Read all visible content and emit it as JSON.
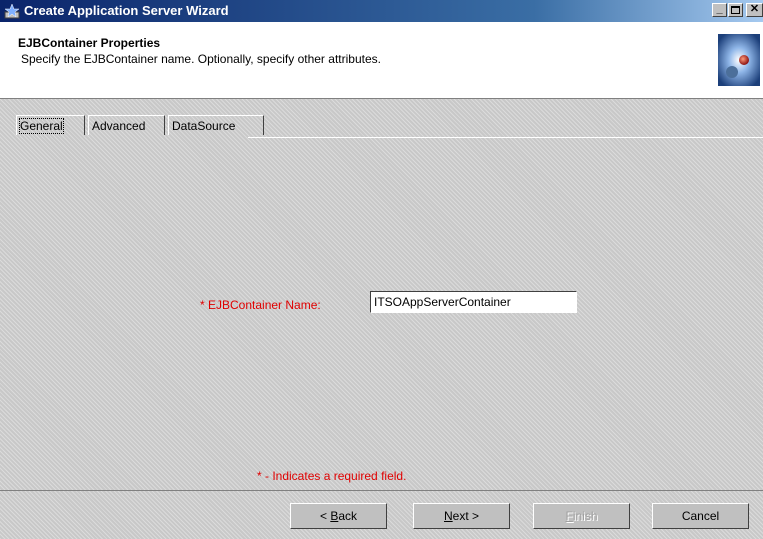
{
  "window": {
    "title": "Create Application Server Wizard",
    "controls": {
      "minimize_icon": "minimize-icon",
      "maximize_icon": "maximize-icon",
      "close_icon": "close-icon"
    }
  },
  "header": {
    "title": "EJBContainer Properties",
    "subtitle": "Specify the EJBContainer name.  Optionally, specify other attributes."
  },
  "tabs": [
    {
      "label": "General",
      "selected": true
    },
    {
      "label": "Advanced",
      "selected": false
    },
    {
      "label": "DataSource",
      "selected": false
    }
  ],
  "form": {
    "name_label": "* EJBContainer Name:",
    "name_value": "ITSOAppServerContainer",
    "required_note": "* - Indicates a required field."
  },
  "buttons": {
    "back": {
      "prefix": "< ",
      "mnemonic": "B",
      "rest": "ack"
    },
    "next": {
      "mnemonic": "N",
      "rest": "ext >"
    },
    "finish": {
      "mnemonic": "F",
      "rest": "inish",
      "enabled": false
    },
    "cancel": "Cancel"
  },
  "colors": {
    "titlebar": "#0a246a",
    "required": "#e00000",
    "face": "#c0c0c0"
  }
}
